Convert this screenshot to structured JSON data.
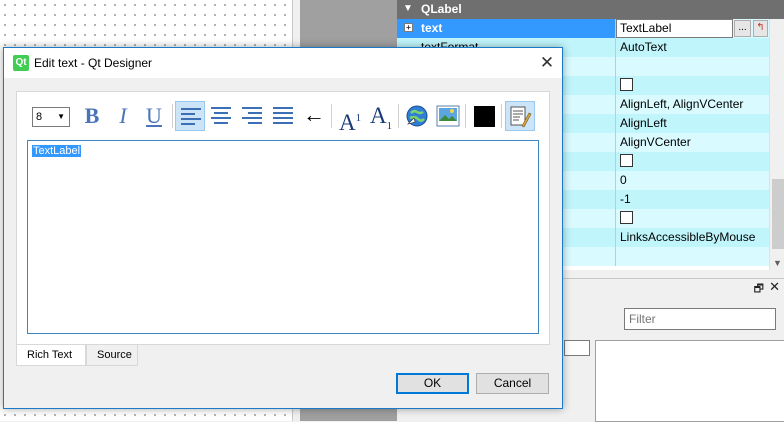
{
  "dialog": {
    "title": "Edit text - Qt Designer",
    "app_icon_text": "Qt",
    "toolbar": {
      "font_size": "8",
      "bold_glyph": "B",
      "italic_glyph": "I",
      "underline_glyph": "U",
      "arrow_glyph": "←",
      "superscript_glyph": "A",
      "superscript_mark": "1",
      "subscript_glyph": "A",
      "subscript_mark": "1"
    },
    "editor_text": "TextLabel",
    "tabs": [
      {
        "label": "Rich Text",
        "active": true
      },
      {
        "label": "Source",
        "active": false
      }
    ],
    "buttons": {
      "ok": "OK",
      "cancel": "Cancel"
    }
  },
  "property_editor": {
    "section": "QLabel",
    "rows": [
      {
        "name": "text",
        "value": "TextLabel",
        "selected": true
      },
      {
        "name": "textFormat",
        "value": "AutoText"
      },
      {
        "name": "",
        "value": ""
      },
      {
        "name": "",
        "value": "",
        "checkbox": true
      },
      {
        "name": "",
        "value": "AlignLeft, AlignVCenter"
      },
      {
        "name": "",
        "value": "AlignLeft"
      },
      {
        "name": "",
        "value": "AlignVCenter"
      },
      {
        "name": "",
        "value": "",
        "checkbox": true
      },
      {
        "name": "",
        "value": "0"
      },
      {
        "name": "",
        "value": "-1"
      },
      {
        "name": "",
        "value": "",
        "checkbox": true
      },
      {
        "name": "",
        "value": "LinksAccessibleByMouse"
      },
      {
        "name": "",
        "value": ""
      }
    ],
    "dots_label": "...",
    "reset_glyph": "↰"
  },
  "dock": {
    "filter_placeholder": "Filter",
    "float_glyph": "🗗",
    "close_glyph": "✕"
  },
  "colors": {
    "selection": "#3399ff",
    "row_bg": "#d9fbff",
    "row_alt_bg": "#bff5fb",
    "dialog_border": "#1979ca",
    "text_color_swatch": "#000000"
  },
  "icons": [
    "bold-icon",
    "italic-icon",
    "underline-icon",
    "align-left-icon",
    "align-center-icon",
    "align-right-icon",
    "justify-icon",
    "direction-arrow-icon",
    "superscript-icon",
    "subscript-icon",
    "link-icon",
    "image-icon",
    "text-color-icon",
    "simplify-html-icon"
  ]
}
